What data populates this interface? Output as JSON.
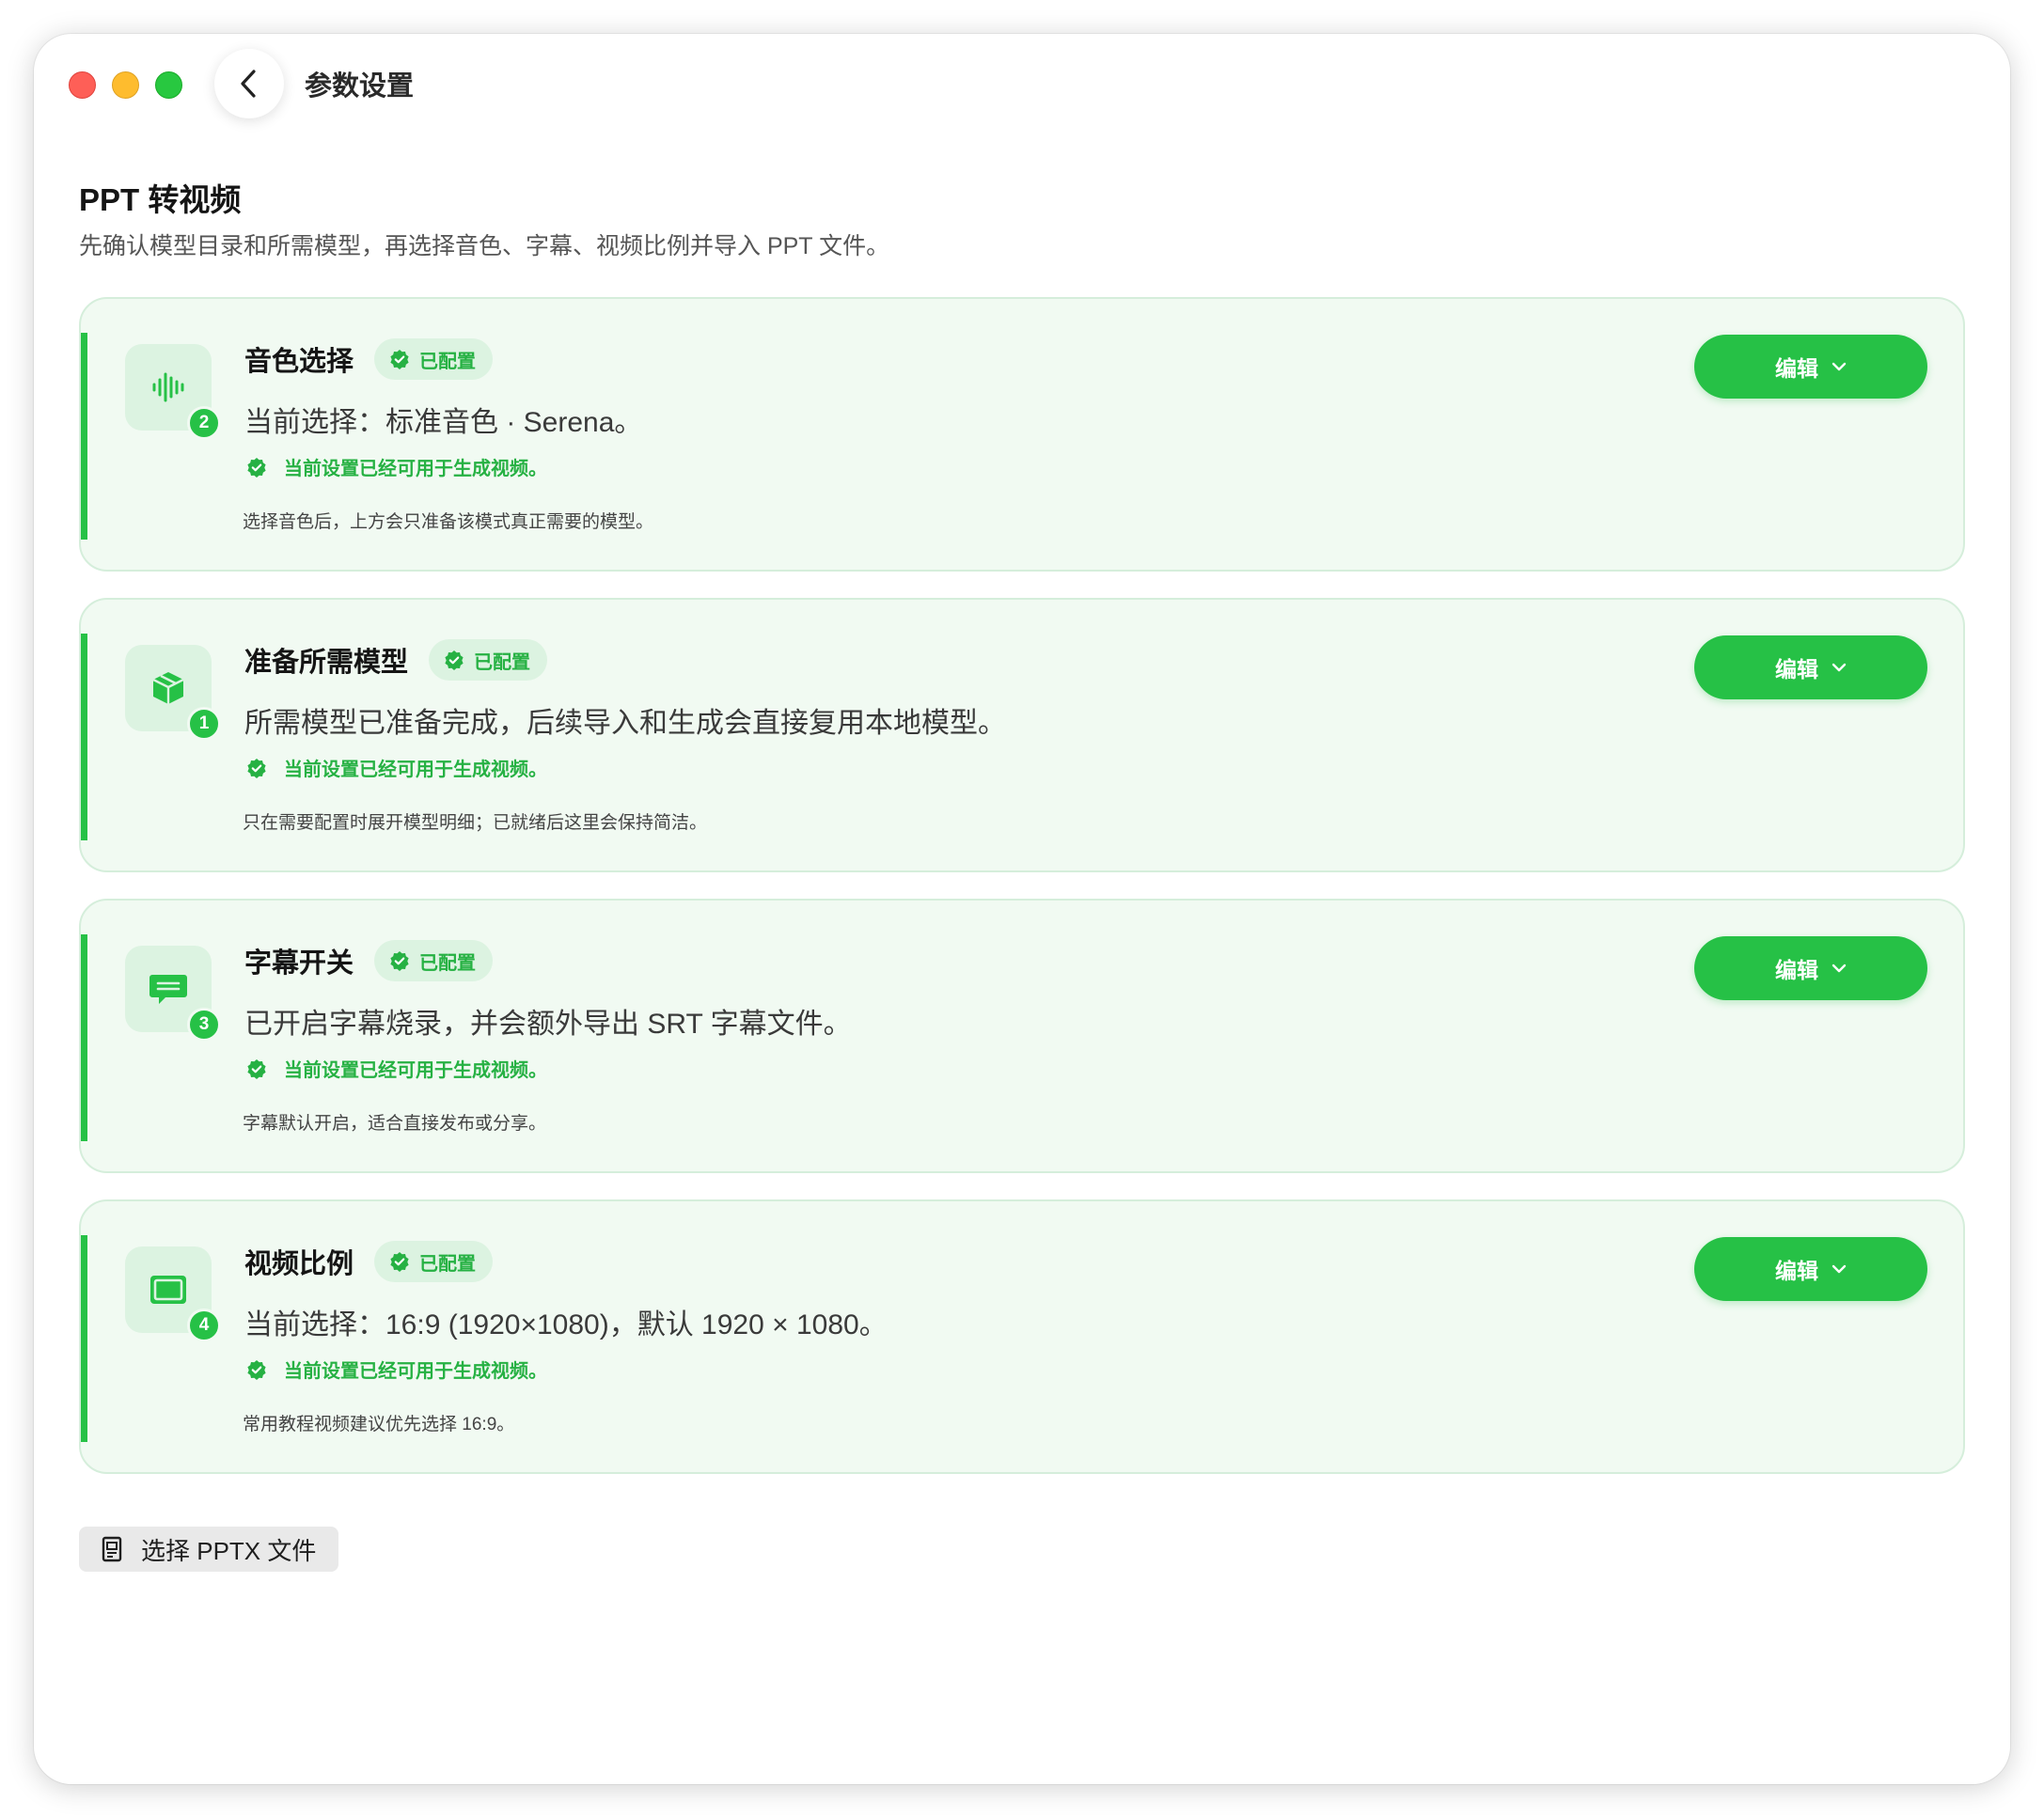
{
  "window": {
    "title": "参数设置"
  },
  "header": {
    "title": "PPT 转视频",
    "subtitle": "先确认模型目录和所需模型，再选择音色、字幕、视频比例并导入 PPT 文件。"
  },
  "cards": [
    {
      "title": "音色选择",
      "status": "已配置",
      "step": "2",
      "icon": "waveform-icon",
      "description": "当前选择：标准音色 · Serena。",
      "ready": "当前设置已经可用于生成视频。",
      "note": "选择音色后，上方会只准备该模式真正需要的模型。",
      "button": "编辑"
    },
    {
      "title": "准备所需模型",
      "status": "已配置",
      "step": "1",
      "icon": "cube-icon",
      "description": "所需模型已准备完成，后续导入和生成会直接复用本地模型。",
      "ready": "当前设置已经可用于生成视频。",
      "note": "只在需要配置时展开模型明细；已就绪后这里会保持简洁。",
      "button": "编辑"
    },
    {
      "title": "字幕开关",
      "status": "已配置",
      "step": "3",
      "icon": "subtitle-bubble-icon",
      "description": "已开启字幕烧录，并会额外导出 SRT 字幕文件。",
      "ready": "当前设置已经可用于生成视频。",
      "note": "字幕默认开启，适合直接发布或分享。",
      "button": "编辑"
    },
    {
      "title": "视频比例",
      "status": "已配置",
      "step": "4",
      "icon": "screen-ratio-icon",
      "description": "当前选择：16:9 (1920×1080)，默认 1920 × 1080。",
      "ready": "当前设置已经可用于生成视频。",
      "note": "常用教程视频建议优先选择 16:9。",
      "button": "编辑"
    }
  ],
  "footer": {
    "file_button": "选择 PPTX 文件"
  },
  "colors": {
    "accent": "#26c146",
    "card_bg": "#f1faf2",
    "pill_bg": "#dcf3e1"
  }
}
